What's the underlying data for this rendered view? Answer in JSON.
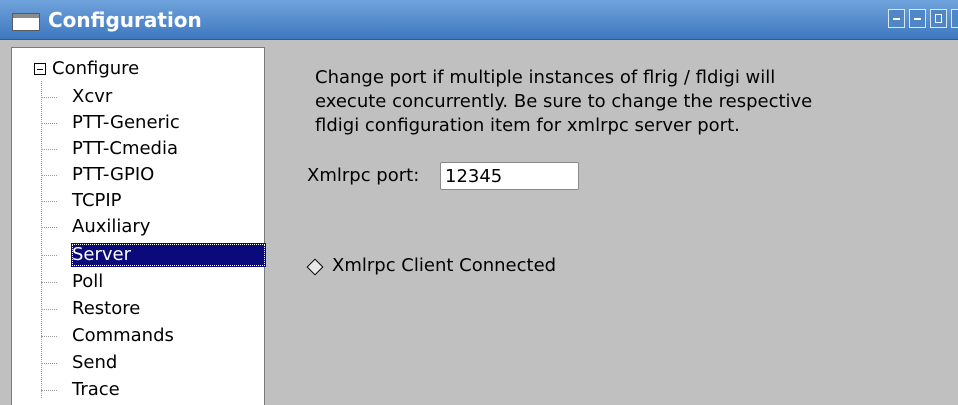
{
  "window": {
    "title": "Configuration"
  },
  "tree": {
    "root_label": "Configure",
    "items": [
      {
        "label": "Xcvr"
      },
      {
        "label": "PTT-Generic"
      },
      {
        "label": "PTT-Cmedia"
      },
      {
        "label": "PTT-GPIO"
      },
      {
        "label": "TCPIP"
      },
      {
        "label": "Auxiliary"
      },
      {
        "label": "Server",
        "selected": true
      },
      {
        "label": "Poll"
      },
      {
        "label": "Restore"
      },
      {
        "label": "Commands"
      },
      {
        "label": "Send"
      },
      {
        "label": "Trace"
      }
    ]
  },
  "server_panel": {
    "description_lines": [
      "Change port if multiple instances of flrig / fldigi will",
      "execute concurrently.  Be sure to change the respective",
      "fldigi configuration item for xmlrpc server port."
    ],
    "port_label": "Xmlrpc port:",
    "port_value": "12345",
    "client_connected_label": "Xmlrpc Client Connected",
    "client_connected": false
  },
  "colors": {
    "titlebar": "#4a86cc",
    "selection": "#0a0a7a",
    "panel_bg": "#c0c0c0"
  }
}
